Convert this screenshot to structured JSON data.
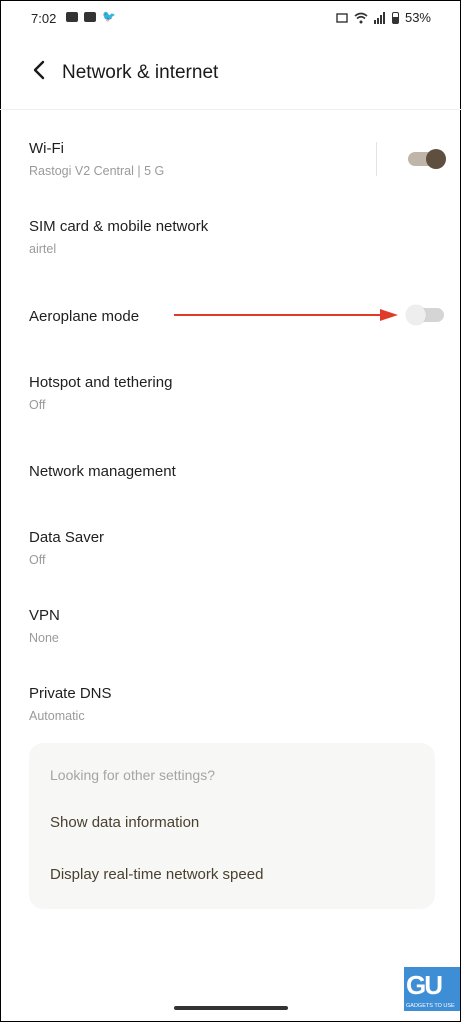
{
  "status_bar": {
    "time": "7:02",
    "battery": "53%",
    "left_icons": [
      "youtube-icon",
      "youtube-icon",
      "twitter-icon"
    ],
    "right_icons": [
      "volte-icon",
      "wifi-icon",
      "signal-icon",
      "battery-icon"
    ]
  },
  "header": {
    "title": "Network & internet",
    "back_icon": "back-arrow-icon"
  },
  "items": [
    {
      "label": "Wi-Fi",
      "sub": "Rastogi V2 Central |  5 G",
      "toggle": "on"
    },
    {
      "label": "SIM card & mobile network",
      "sub": "airtel"
    },
    {
      "label": "Aeroplane mode",
      "toggle": "off"
    },
    {
      "label": "Hotspot and tethering",
      "sub": "Off"
    },
    {
      "label": "Network management"
    },
    {
      "label": "Data Saver",
      "sub": "Off"
    },
    {
      "label": "VPN",
      "sub": "None"
    },
    {
      "label": "Private DNS",
      "sub": "Automatic"
    }
  ],
  "other_settings": {
    "hint": "Looking for other settings?",
    "links": [
      "Show data information",
      "Display real-time network speed"
    ]
  },
  "watermark": {
    "logo": "GU",
    "text": "GADGETS TO USE"
  },
  "colors": {
    "toggle_on_track": "#bfb5a8",
    "toggle_on_knob": "#5f4f3e",
    "toggle_off_track": "#d5d5d5",
    "annotation_arrow": "#e03a2a",
    "watermark_bg": "#3e8ed6"
  }
}
